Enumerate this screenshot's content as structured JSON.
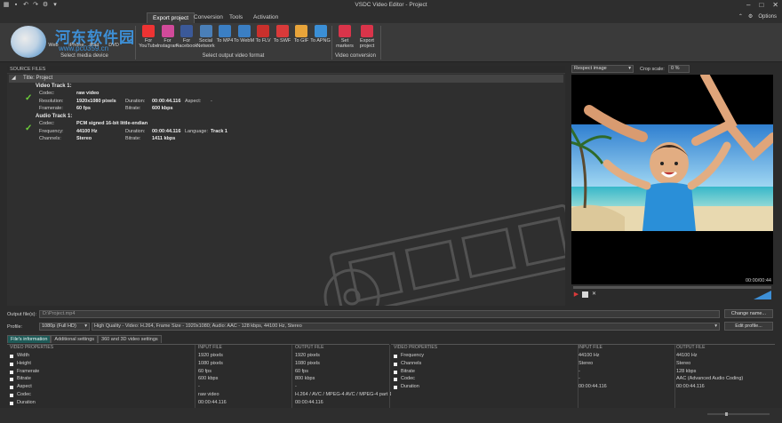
{
  "window": {
    "title": "VSDC Video Editor - Project",
    "qat_icons": [
      "grid-icon",
      "save-icon",
      "undo-icon",
      "redo-icon",
      "settings-icon",
      "dropdown-icon"
    ]
  },
  "watermark": {
    "text": "河东软件园",
    "url": "www.pc0359.cn"
  },
  "ribbon_tabs": [
    "Export project",
    "Conversion",
    "Tools",
    "Activation"
  ],
  "ribbon_right": {
    "options_label": "Options"
  },
  "media_devices": {
    "buttons": [
      "Web",
      "iPhone",
      "iPad",
      "DVD"
    ],
    "group_label": "Select media device"
  },
  "formats": {
    "buttons": [
      {
        "label": "For YouTube",
        "icon": "youtube-icon",
        "color": "#e33"
      },
      {
        "label": "For Instagram",
        "icon": "instagram-icon",
        "color": "#d14a9a"
      },
      {
        "label": "For Facebook",
        "icon": "facebook-icon",
        "color": "#3b5998"
      },
      {
        "label": "Social Network",
        "icon": "social-network-icon",
        "color": "#4a7fb8"
      },
      {
        "label": "To MP4",
        "icon": "mp4-icon",
        "color": "#3b7fc4"
      },
      {
        "label": "To WebM",
        "icon": "webm-icon",
        "color": "#3b7fc4"
      },
      {
        "label": "To FLV",
        "icon": "flv-icon",
        "color": "#c9302c"
      },
      {
        "label": "To SWF",
        "icon": "swf-icon",
        "color": "#d93a3a"
      },
      {
        "label": "To GIF",
        "icon": "gif-icon",
        "color": "#e8a43a"
      },
      {
        "label": "To APNG",
        "icon": "apng-icon",
        "color": "#3b8fd6"
      }
    ],
    "group_label": "Select output video format"
  },
  "conversion": {
    "buttons": [
      {
        "label": "Set markers",
        "icon": "marker-icon",
        "color": "#d9344a"
      },
      {
        "label": "Export project",
        "icon": "export-icon",
        "color": "#d9344a"
      }
    ],
    "group_label": "Video conversion"
  },
  "source": {
    "header": "SOURCE FILES",
    "project_title": "Title: Project",
    "video": {
      "title": "Video Track 1:",
      "codec_k": "Codec:",
      "codec_v": "raw video",
      "res_k": "Resolution:",
      "res_v": "1920x1080 pixels",
      "fr_k": "Framerate:",
      "fr_v": "60 fps",
      "dur_k": "Duration:",
      "dur_v": "00:00:44.116",
      "br_k": "Bitrate:",
      "br_v": "600 kbps",
      "asp_k": "Aspect:",
      "asp_v": "-"
    },
    "audio": {
      "title": "Audio Track 1:",
      "codec_k": "Codec:",
      "codec_v": "PCM signed 16-bit little-endian",
      "freq_k": "Frequency:",
      "freq_v": "44100 Hz",
      "ch_k": "Channels:",
      "ch_v": "Stereo",
      "dur_k": "Duration:",
      "dur_v": "00:00:44.116",
      "br_k": "Bitrate:",
      "br_v": "1411 kbps",
      "lang_k": "Language:",
      "lang_v": "Track 1"
    }
  },
  "preview": {
    "aspect_select": "Respect image",
    "crop_label": "Crop scale:",
    "crop_value": "0 %",
    "time": "00:00/00:44",
    "progress": 0
  },
  "output": {
    "file_label": "Output file(s):",
    "file_value": "D:\\Project.mp4",
    "change_name": "Change name...",
    "profile_label": "Profile:",
    "profile_value": "1080p (Full HD)",
    "profile_desc": "High Quality - Video: H.264, Frame Size - 1920x1080; Audio: AAC - 128 kbps, 44100 Hz, Stereo",
    "edit_profile": "Edit profile..."
  },
  "bottom_tabs": [
    "File's information",
    "Additional settings",
    "360 and 3D video settings"
  ],
  "video_props": {
    "headers": [
      "VIDEO PROPERTIES",
      "INPUT FILE",
      "OUTPUT FILE"
    ],
    "rows": [
      [
        "Width",
        "1920 pixels",
        "1920 pixels"
      ],
      [
        "Height",
        "1080 pixels",
        "1080 pixels"
      ],
      [
        "Framerate",
        "60 fps",
        "60 fps"
      ],
      [
        "Bitrate",
        "600 kbps",
        "800 kbps"
      ],
      [
        "Aspect",
        "-",
        "-"
      ],
      [
        "Codec",
        "raw video",
        "H.264 / AVC / MPEG-4 AVC / MPEG-4 part 10"
      ],
      [
        "Duration",
        "00:00:44.116",
        "00:00:44.116"
      ]
    ]
  },
  "audio_props": {
    "headers": [
      "VIDEO PROPERTIES",
      "INPUT FILE",
      "OUTPUT FILE"
    ],
    "rows": [
      [
        "Frequency",
        "44100 Hz",
        "44100 Hz"
      ],
      [
        "Channels",
        "Stereo",
        "Stereo"
      ],
      [
        "Bitrate",
        "-",
        "128 kbps"
      ],
      [
        "Codec",
        "-",
        "AAC (Advanced Audio Coding)"
      ],
      [
        "Duration",
        "00:00:44.116",
        "00:00:44.116"
      ]
    ]
  }
}
